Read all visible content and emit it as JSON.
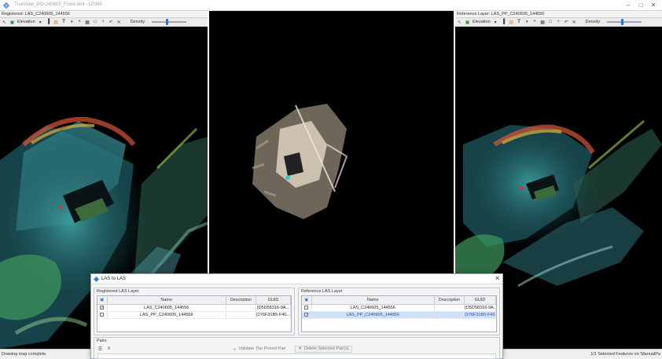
{
  "window": {
    "title": "TrueView_GO-240605_Frank.xml - LP360",
    "minimize_glyph": "–",
    "maximize_glyph": "□",
    "close_glyph": "✕"
  },
  "left_panel": {
    "header": "Registered: LAS_C240605_144556",
    "layer_dropdown": "Elevation",
    "density_label": "Density:",
    "density_level": 0.42
  },
  "right_panel": {
    "header": "Reference Layer: LAS_PP_C240605_144556",
    "layer_dropdown": "Elevation",
    "density_label": "Density:",
    "density_level": 0.42
  },
  "toolbar_icons": [
    "select-arrow-icon",
    "layer-icon",
    "grid-icon",
    "ruler-icon",
    "text-icon",
    "globe-icon",
    "tie-point-icon",
    "image-icon",
    "frame-icon",
    "plus-icon",
    "undo-icon",
    "delete-x-icon"
  ],
  "dialog": {
    "title": "LAS to LAS",
    "close_glyph": "✕",
    "registered_group": {
      "label": "Registered LAS Layer",
      "columns": [
        "",
        "Name",
        "Description",
        "GUID"
      ],
      "rows": [
        {
          "checked": true,
          "name": "LAS_C240605_144556",
          "description": "",
          "guid": "{D5D58316-9A...",
          "selected": false
        },
        {
          "checked": false,
          "name": "LAS_PP_C240605_144556",
          "description": "",
          "guid": "{276F31B5-F40...",
          "selected": false
        }
      ]
    },
    "reference_group": {
      "label": "Reference LAS Layer",
      "columns": [
        "",
        "Name",
        "Description",
        "GUID"
      ],
      "rows": [
        {
          "checked": false,
          "name": "LAS_C240605_144556",
          "description": "",
          "guid": "{D5D58316-9A...",
          "selected": false
        },
        {
          "checked": true,
          "name": "LAS_PP_C240605_144556",
          "description": "",
          "guid": "{276F31B5-F40...",
          "selected": true
        }
      ]
    },
    "pairs": {
      "label": "Pairs",
      "validate_label": "Validate The Picked Pair",
      "delete_label": "Delete Selected Pair(s)"
    }
  },
  "status": {
    "left": "Drawing map complete.",
    "right": "1/1 Selected Features on 'ManualPa"
  },
  "colors": {
    "accent": "#2a6fd6",
    "selection": "#cfe0fb"
  }
}
